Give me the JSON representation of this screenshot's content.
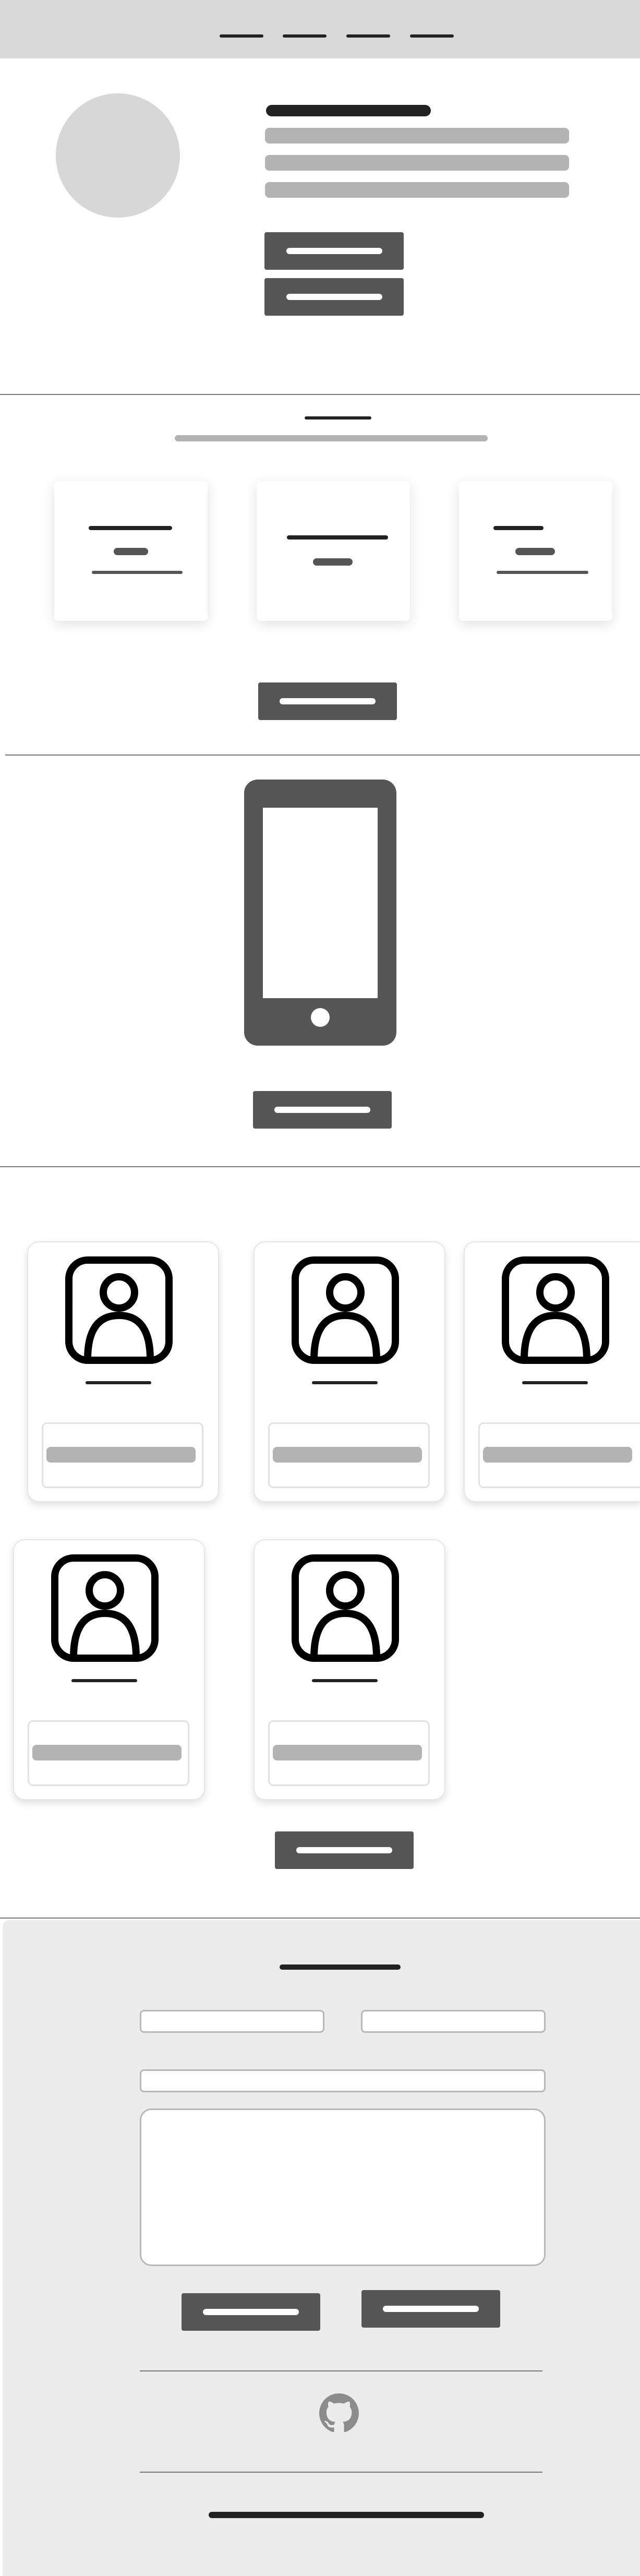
{
  "nav": {
    "items": [
      {
        "label": ""
      },
      {
        "label": ""
      },
      {
        "label": ""
      },
      {
        "label": ""
      }
    ]
  },
  "hero": {
    "buttons": [
      {
        "label": ""
      },
      {
        "label": ""
      }
    ]
  },
  "features": {
    "cards": [
      {},
      {},
      {}
    ],
    "cta": {
      "label": ""
    }
  },
  "app": {
    "cta": {
      "label": ""
    }
  },
  "team": {
    "members": [
      {},
      {},
      {},
      {},
      {}
    ],
    "cta": {
      "label": ""
    }
  },
  "contact": {
    "fields": {
      "first_placeholder": "",
      "second_placeholder": "",
      "wide_placeholder": "",
      "message_placeholder": ""
    },
    "buttons": [
      {
        "label": ""
      },
      {
        "label": ""
      }
    ],
    "icons": [
      "github-icon"
    ]
  },
  "colors": {
    "header_bg": "#d9d9d9",
    "button_bg": "#565656",
    "contact_bg": "#ececec",
    "avatar_bg": "#d7d7d7"
  }
}
